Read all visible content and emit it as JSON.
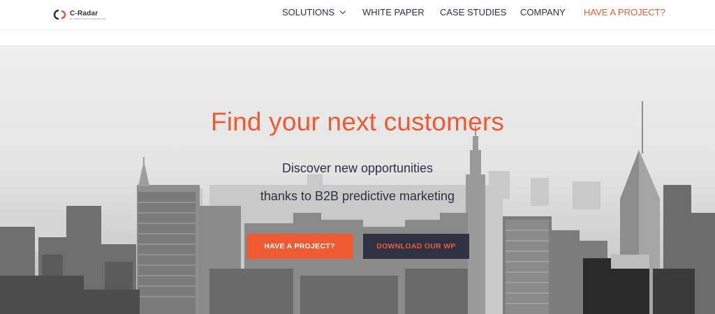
{
  "logo": {
    "name": "C-Radar",
    "tagline": "BUSINESS PREDICTIVE ENGINE"
  },
  "nav": {
    "items": [
      {
        "label": "SOLUTIONS",
        "has_dropdown": true
      },
      {
        "label": "WHITE PAPER"
      },
      {
        "label": "CASE STUDIES"
      },
      {
        "label": "COMPANY"
      },
      {
        "label": "HAVE A PROJECT?"
      }
    ]
  },
  "hero": {
    "title": "Find your next customers",
    "line1": "Discover new opportunities",
    "line2": "thanks to B2B predictive marketing",
    "primary_cta": "HAVE A PROJECT?",
    "secondary_cta": "DOWNLOAD OUR WP"
  },
  "colors": {
    "accent": "#f05a33",
    "dark": "#2d3142",
    "background": "#ffffff"
  },
  "icons": {
    "logo_mark": "c-radar-logo-icon",
    "dropdown": "chevron-down-icon"
  }
}
